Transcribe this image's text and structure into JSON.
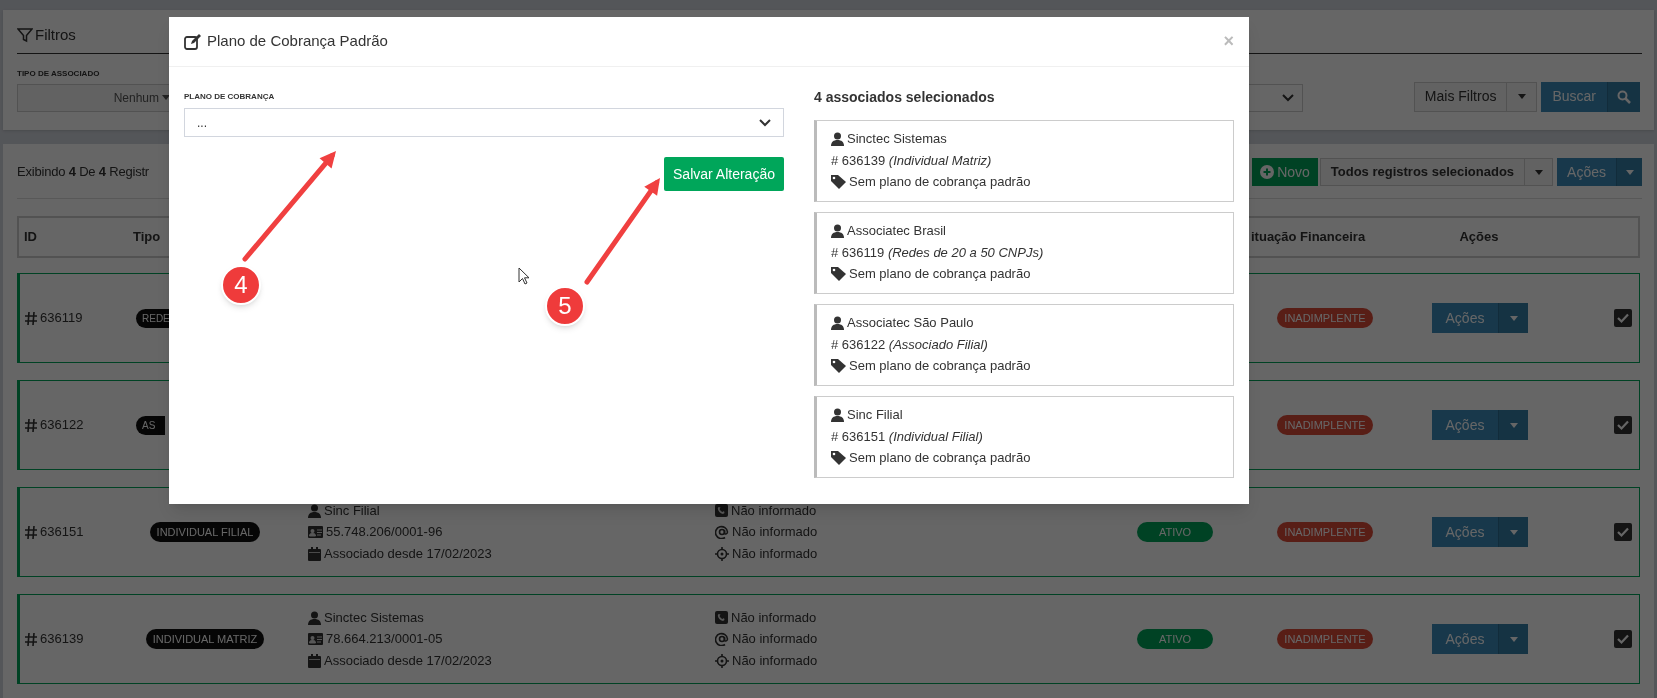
{
  "filters": {
    "title": "Filtros",
    "field_label": "TIPO DE ASSOCIADO",
    "field_value": "Nenhum",
    "more_button": "Mais Filtros",
    "search_button": "Buscar"
  },
  "list": {
    "summary": "Exibindo **4** De **4** Registr",
    "new_button": "Novo",
    "selection_button": "Todos registros selecionados",
    "actions_button": "Ações"
  },
  "table": {
    "columns": {
      "id": "ID",
      "type": "Tipo",
      "financial": "ituação Financeira",
      "actions": "Ações"
    },
    "rows": [
      {
        "id": "636119",
        "type": "REDE",
        "financial": "INADIMPLENTE",
        "action": "Ações",
        "selected": true,
        "checked": true
      },
      {
        "id": "636122",
        "type": "AS",
        "financial": "INADIMPLENTE",
        "action": "Ações",
        "selected": true,
        "checked": true
      },
      {
        "id": "636151",
        "type": "INDIVIDUAL FILIAL",
        "name": "Sinc Filial",
        "document": "55.748.206/0001-96",
        "since": "Associado desde 17/02/2023",
        "phone": "Não informado",
        "email": "Não informado",
        "address": "Não informado",
        "status": "ATIVO",
        "financial": "INADIMPLENTE",
        "action": "Ações",
        "selected": true,
        "checked": true
      },
      {
        "id": "636139",
        "type": "INDIVIDUAL MATRIZ",
        "name": "Sinctec Sistemas",
        "document": "78.664.213/0001-05",
        "since": "Associado desde 17/02/2023",
        "phone": "Não informado",
        "email": "Não informado",
        "address": "Não informado",
        "status": "ATIVO",
        "financial": "INADIMPLENTE",
        "action": "Ações",
        "selected": true,
        "checked": true
      }
    ]
  },
  "modal": {
    "title": "Plano de Cobrança Padrão",
    "close": "×",
    "field_label": "PLANO DE COBRANÇA",
    "field_value": "...",
    "save_button": "Salvar Alteração",
    "heading": "4 associados selecionados",
    "items": [
      {
        "name": "Sinctec Sistemas",
        "ref": "# 636139 *(Individual Matriz)*",
        "plan": "Sem plano de cobrança padrão"
      },
      {
        "name": "Associatec Brasil",
        "ref": "# 636119 *(Redes de 20 a 50 CNPJs)*",
        "plan": "Sem plano de cobrança padrão"
      },
      {
        "name": "Associatec São Paulo",
        "ref": "# 636122 *(Associado Filial)*",
        "plan": "Sem plano de cobrança padrão"
      },
      {
        "name": "Sinc Filial",
        "ref": "# 636151 *(Individual Filial)*",
        "plan": "Sem plano de cobrança padrão"
      }
    ]
  },
  "annotations": [
    {
      "label": "4"
    },
    {
      "label": "5"
    }
  ]
}
